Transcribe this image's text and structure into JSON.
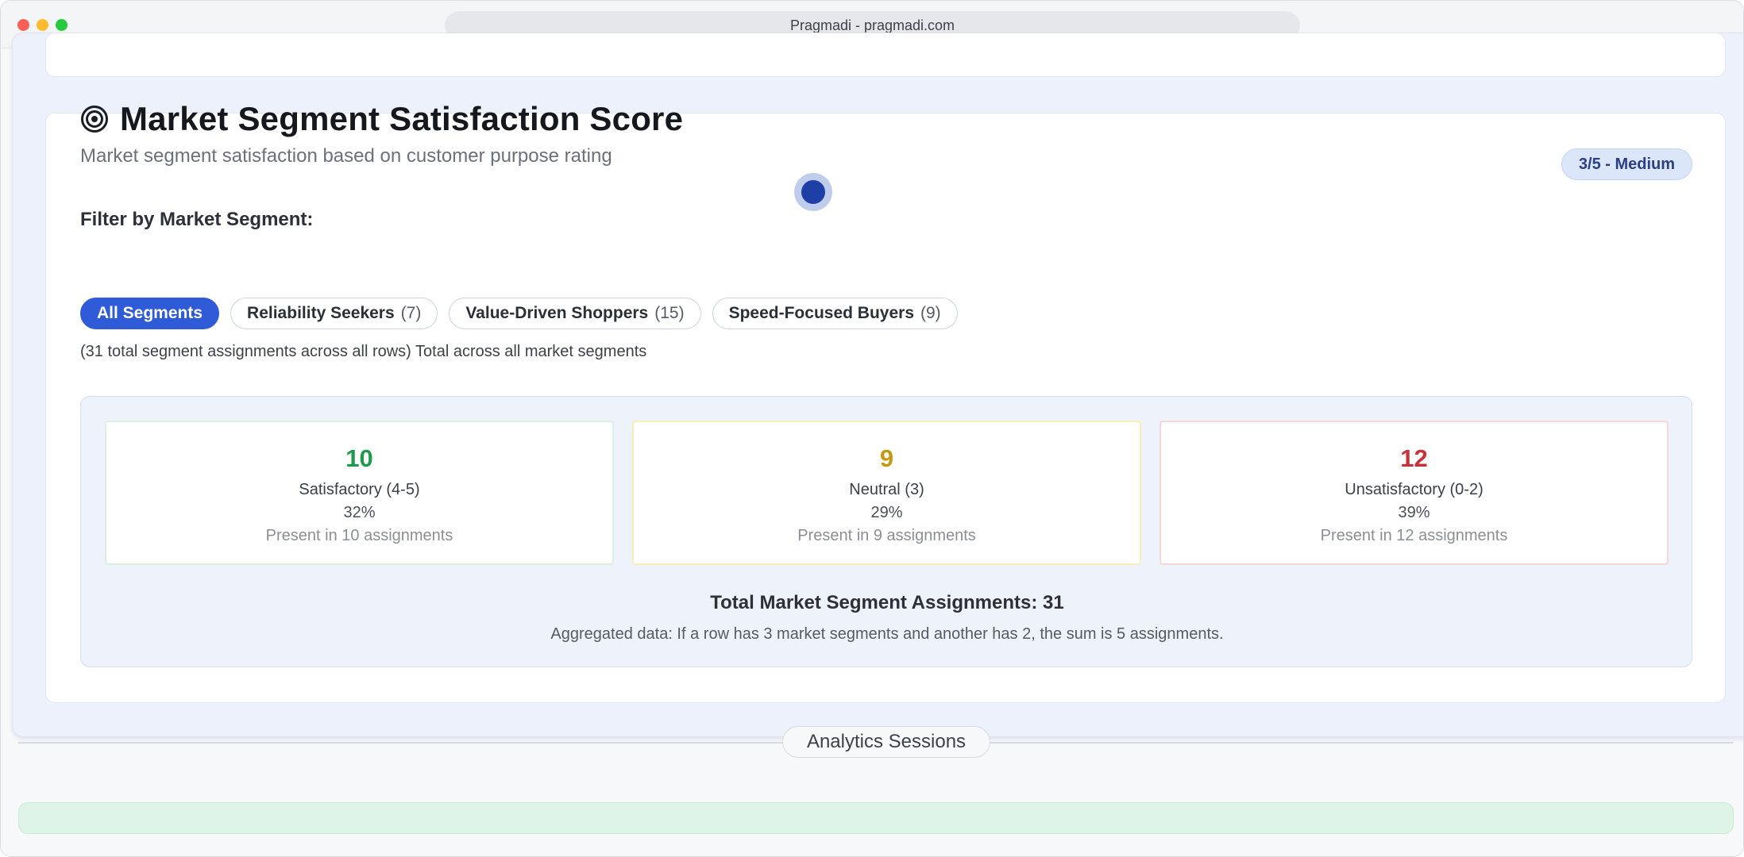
{
  "browser": {
    "url_text": "Pragmadi - pragmadi.com"
  },
  "section": {
    "title": "Market Segment Satisfaction Score",
    "subtitle": "Market segment satisfaction based on customer purpose rating",
    "badge": "3/5 - Medium",
    "filter_label": "Filter by Market Segment:",
    "total_note": "(31 total segment assignments across all rows) Total across all market segments"
  },
  "chips": [
    {
      "name": "All Segments",
      "count": "",
      "active": true
    },
    {
      "name": "Reliability Seekers",
      "count": "(7)",
      "active": false
    },
    {
      "name": "Value-Driven Shoppers",
      "count": "(15)",
      "active": false
    },
    {
      "name": "Speed-Focused Buyers",
      "count": "(9)",
      "active": false
    }
  ],
  "stats": {
    "satisfactory": {
      "value": "10",
      "label": "Satisfactory (4-5)",
      "percent": "32%",
      "present": "Present in 10 assignments",
      "color": "#1f9a4c"
    },
    "neutral": {
      "value": "9",
      "label": "Neutral (3)",
      "percent": "29%",
      "present": "Present in 9 assignments",
      "color": "#c49a14"
    },
    "unsatisfactory": {
      "value": "12",
      "label": "Unsatisfactory (0-2)",
      "percent": "39%",
      "present": "Present in 12 assignments",
      "color": "#c63238"
    },
    "total": "Total Market Segment Assignments: 31",
    "note": "Aggregated data: If a row has 3 market segments and another has 2, the sum is 5 assignments."
  },
  "sessions": {
    "label": "Analytics Sessions"
  },
  "colors": {
    "accent": "#2f5ad8",
    "badge_bg": "#dbe6fb",
    "panel_bg": "#eef2fb"
  },
  "icons": {
    "title_icon": "target-icon"
  }
}
